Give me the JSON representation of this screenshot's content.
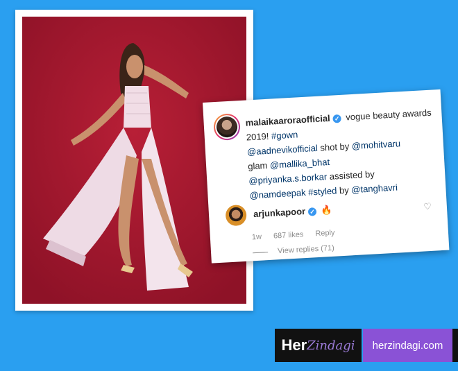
{
  "instagram": {
    "username": "malaikaaroraofficial",
    "caption_text": "vogue beauty awards 2019!",
    "hashtag_gown": "#gown",
    "mention_aadnevik": "@aadnevikofficial",
    "shot_by": "shot by",
    "mention_mohitvaru": "@mohitvaru",
    "glam": "glam",
    "mention_mallika": "@mallika_bhat",
    "mention_priyanka": "@priyanka.s.borkar",
    "assisted_by": "assisted by",
    "mention_namdeepak": "@namdeepak",
    "hashtag_styled": "#styled",
    "by": "by",
    "mention_tanghavri": "@tanghavri",
    "comment_user": "arjunkapoor",
    "comment_emoji": "🔥",
    "time": "1w",
    "likes": "687 likes",
    "reply": "Reply",
    "view_replies": "View replies (71)"
  },
  "logo": {
    "her": "Her",
    "zindagi": "Zindagi",
    "site": "herzindagi.com"
  },
  "icons": {
    "verified": "verified-badge-icon",
    "heart": "heart-outline-icon"
  },
  "colors": {
    "background": "#2a9ff0",
    "photo_backdrop": "#a8162e",
    "logo_purple": "#8a52d6"
  }
}
